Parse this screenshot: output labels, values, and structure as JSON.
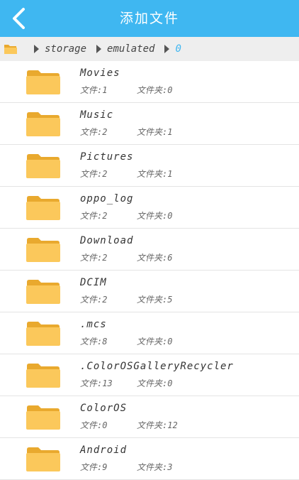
{
  "header": {
    "title": "添加文件"
  },
  "breadcrumb": [
    "storage",
    "emulated",
    "0"
  ],
  "labels": {
    "files": "文件:",
    "folders": "文件夹:"
  },
  "items": [
    {
      "name": "Movies",
      "files": "1",
      "folders": "0"
    },
    {
      "name": "Music",
      "files": "2",
      "folders": "1"
    },
    {
      "name": "Pictures",
      "files": "2",
      "folders": "1"
    },
    {
      "name": "oppo_log",
      "files": "2",
      "folders": "0"
    },
    {
      "name": "Download",
      "files": "2",
      "folders": "6"
    },
    {
      "name": "DCIM",
      "files": "2",
      "folders": "5"
    },
    {
      "name": ".mcs",
      "files": "8",
      "folders": "0"
    },
    {
      "name": ".ColorOSGalleryRecycler",
      "files": "13",
      "folders": "0"
    },
    {
      "name": "ColorOS",
      "files": "0",
      "folders": "12"
    },
    {
      "name": "Android",
      "files": "9",
      "folders": "3"
    }
  ],
  "colors": {
    "accent": "#3fb7f1",
    "folder": "#fbc85b"
  }
}
